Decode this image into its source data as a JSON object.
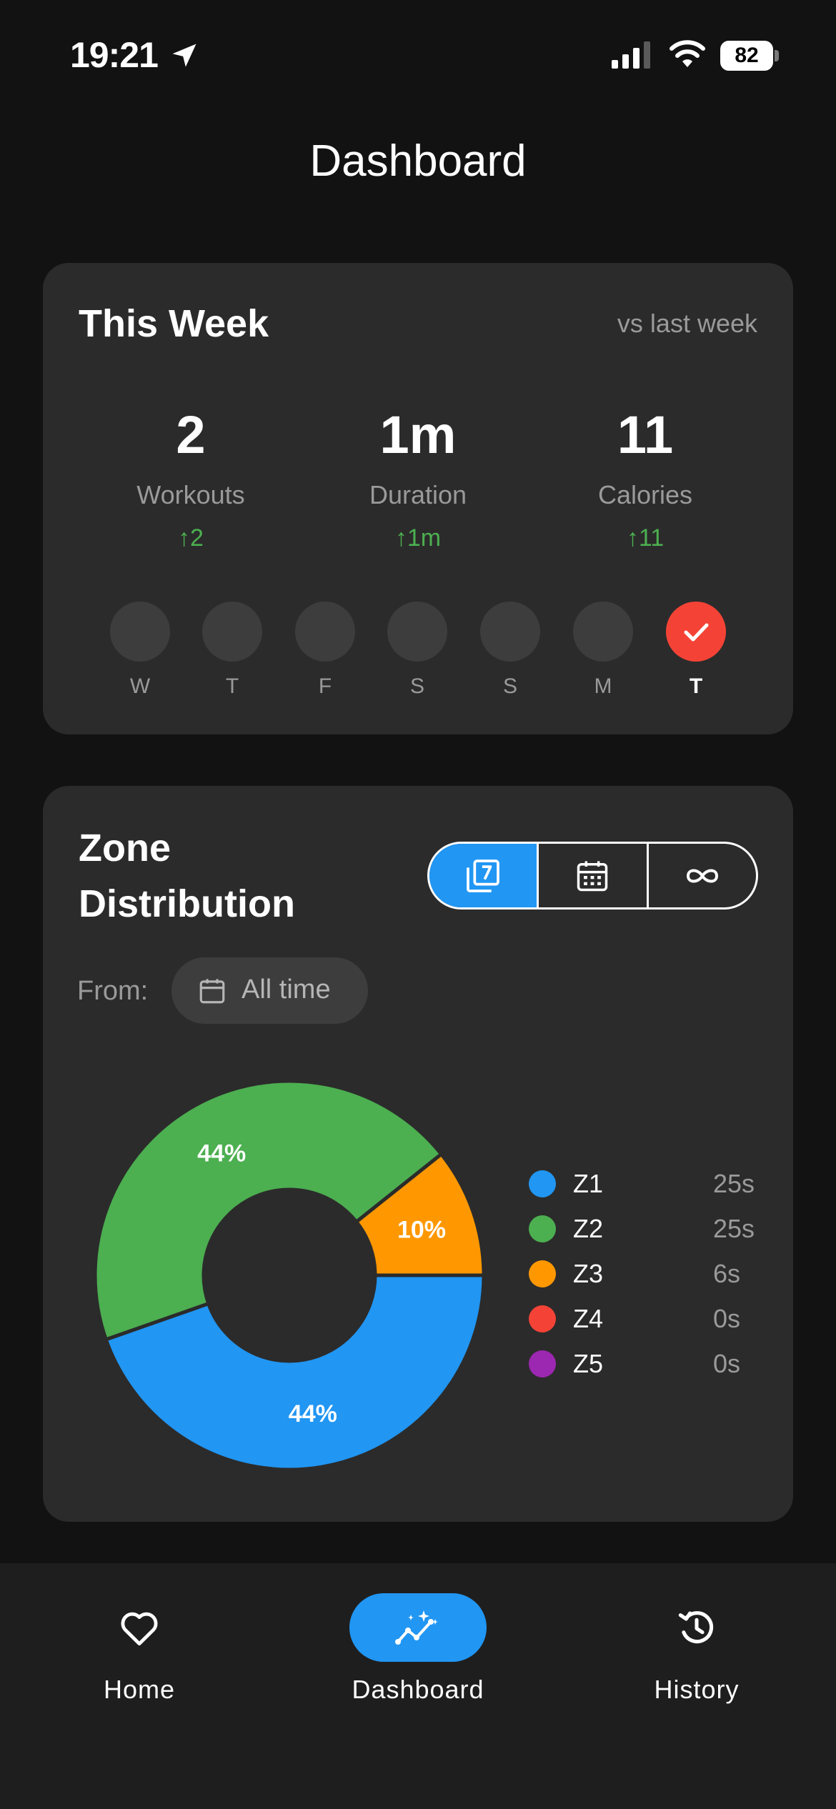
{
  "status_bar": {
    "time": "19:21",
    "battery": "82",
    "icons": [
      "location-arrow-icon",
      "cell-signal-icon",
      "wifi-icon",
      "battery-icon"
    ]
  },
  "header": {
    "title": "Dashboard"
  },
  "this_week": {
    "title": "This Week",
    "comparison_label": "vs last week",
    "stats": [
      {
        "value": "2",
        "label": "Workouts",
        "delta": "2"
      },
      {
        "value": "1m",
        "label": "Duration",
        "delta": "1m"
      },
      {
        "value": "11",
        "label": "Calories",
        "delta": "11"
      }
    ],
    "delta_color": "#4caf50",
    "days": [
      {
        "letter": "W",
        "done": false
      },
      {
        "letter": "T",
        "done": false
      },
      {
        "letter": "F",
        "done": false
      },
      {
        "letter": "S",
        "done": false
      },
      {
        "letter": "S",
        "done": false
      },
      {
        "letter": "M",
        "done": false
      },
      {
        "letter": "T",
        "done": true
      }
    ],
    "done_color": "#f44336"
  },
  "zone_distribution": {
    "title_line1": "Zone",
    "title_line2": "Distribution",
    "range_options": [
      {
        "icon": "last-7-days-icon",
        "selected": true
      },
      {
        "icon": "calendar-icon",
        "selected": false
      },
      {
        "icon": "infinity-icon",
        "selected": false
      }
    ],
    "from_label": "From:",
    "from_value": "All time",
    "legend": [
      {
        "name": "Z1",
        "value": "25s",
        "color": "#2196f3"
      },
      {
        "name": "Z2",
        "value": "25s",
        "color": "#4caf50"
      },
      {
        "name": "Z3",
        "value": "6s",
        "color": "#ff9800"
      },
      {
        "name": "Z4",
        "value": "0s",
        "color": "#f44336"
      },
      {
        "name": "Z5",
        "value": "0s",
        "color": "#9c27b0"
      }
    ]
  },
  "chart_data": {
    "type": "pie",
    "categories": [
      "Z1",
      "Z2",
      "Z3",
      "Z4",
      "Z5"
    ],
    "values": [
      25,
      25,
      6,
      0,
      0
    ],
    "data_labels": [
      "44%",
      "44%",
      "10%",
      "",
      ""
    ],
    "colors": [
      "#2196f3",
      "#4caf50",
      "#ff9800",
      "#f44336",
      "#9c27b0"
    ],
    "donut": true
  },
  "bottom_nav": {
    "items": [
      {
        "label": "Home",
        "icon": "heart-icon",
        "active": false
      },
      {
        "label": "Dashboard",
        "icon": "chart-sparkle-icon",
        "active": true
      },
      {
        "label": "History",
        "icon": "history-icon",
        "active": false
      }
    ],
    "accent": "#2196f3"
  }
}
